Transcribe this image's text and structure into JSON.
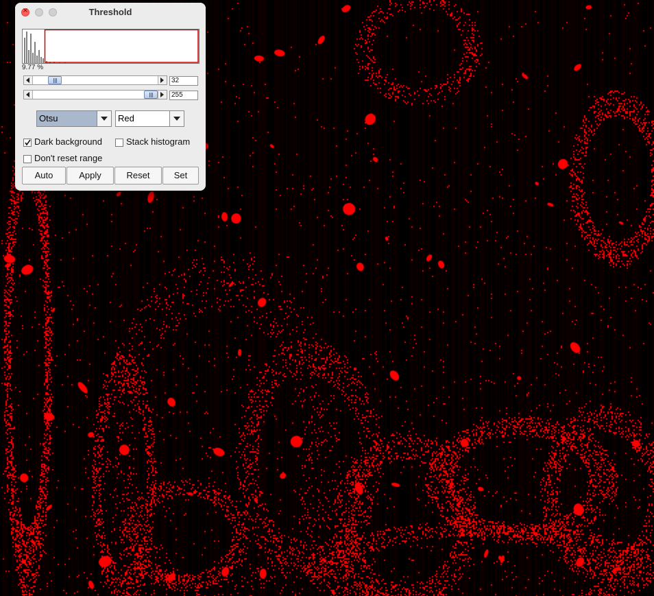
{
  "window": {
    "title": "Threshold"
  },
  "histogram": {
    "percent": "9.77 %"
  },
  "sliders": {
    "min": {
      "value": "32"
    },
    "max": {
      "value": "255"
    }
  },
  "dropdowns": {
    "method": {
      "selected": "Otsu"
    },
    "display": {
      "selected": "Red"
    }
  },
  "checkboxes": {
    "dark_background": {
      "label": "Dark background",
      "checked": true
    },
    "stack_histogram": {
      "label": "Stack histogram",
      "checked": false
    },
    "dont_reset_range": {
      "label": "Don't reset range",
      "checked": false
    }
  },
  "buttons": {
    "auto": "Auto",
    "apply": "Apply",
    "reset": "Reset",
    "set": "Set"
  },
  "colors": {
    "threshold_overlay": "#ff0000",
    "image_background": "#000000",
    "selected_dropdown": "#a9b8cd"
  },
  "icons": {
    "close": "close-icon",
    "minimize": "minimize-icon",
    "maximize": "maximize-icon",
    "slider_left": "arrow-left-icon",
    "slider_right": "arrow-right-icon",
    "dropdown": "chevron-down-icon",
    "check": "checkmark-icon"
  }
}
